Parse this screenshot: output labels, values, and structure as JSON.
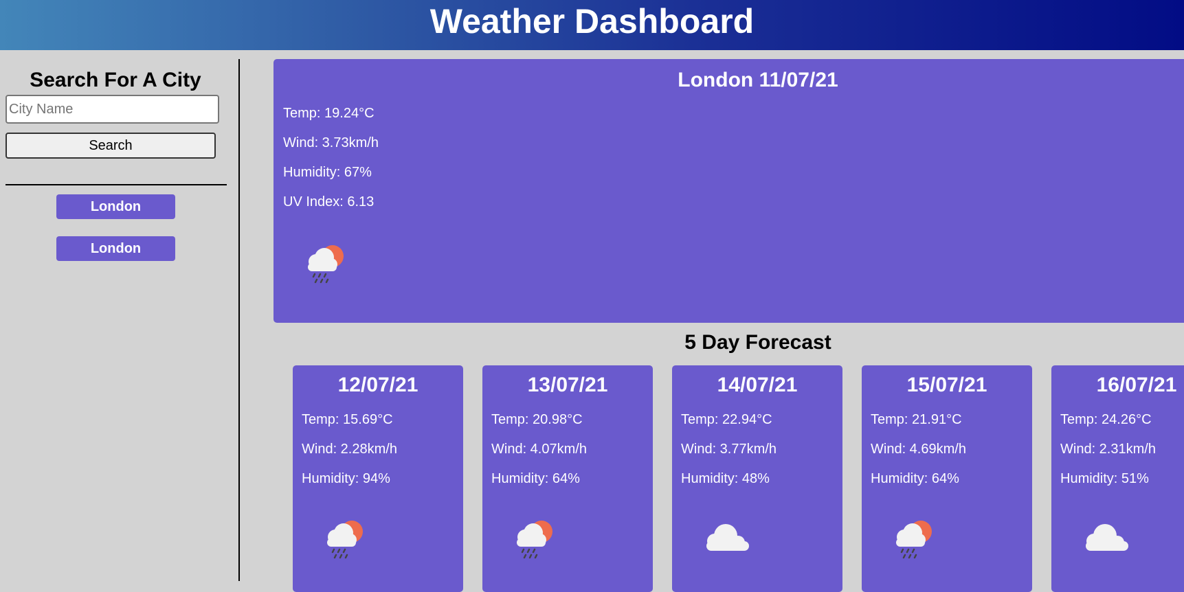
{
  "header": {
    "title": "Weather Dashboard"
  },
  "sidebar": {
    "title": "Search For A City",
    "search_placeholder": "City Name",
    "search_button": "Search",
    "history": [
      "London",
      "London"
    ]
  },
  "current": {
    "title": "London 11/07/21",
    "temp": "Temp: 19.24°C",
    "wind": "Wind: 3.73km/h",
    "humidity": "Humidity: 67%",
    "uv": "UV Index: 6.13",
    "icon": "rain-sun-cloud-icon"
  },
  "forecast": {
    "title": "5 Day Forecast",
    "days": [
      {
        "date": "12/07/21",
        "temp": "Temp: 15.69°C",
        "wind": "Wind: 2.28km/h",
        "humidity": "Humidity: 94%",
        "icon": "rain-sun-cloud-icon"
      },
      {
        "date": "13/07/21",
        "temp": "Temp: 20.98°C",
        "wind": "Wind: 4.07km/h",
        "humidity": "Humidity: 64%",
        "icon": "rain-sun-cloud-icon"
      },
      {
        "date": "14/07/21",
        "temp": "Temp: 22.94°C",
        "wind": "Wind: 3.77km/h",
        "humidity": "Humidity: 48%",
        "icon": "cloud-icon"
      },
      {
        "date": "15/07/21",
        "temp": "Temp: 21.91°C",
        "wind": "Wind: 4.69km/h",
        "humidity": "Humidity: 64%",
        "icon": "rain-sun-cloud-icon"
      },
      {
        "date": "16/07/21",
        "temp": "Temp: 24.26°C",
        "wind": "Wind: 2.31km/h",
        "humidity": "Humidity: 51%",
        "icon": "cloud-icon"
      }
    ]
  },
  "colors": {
    "accent": "#6a5acd",
    "background": "#d3d3d3",
    "header_start": "#4386b9",
    "header_end": "#020c85"
  }
}
